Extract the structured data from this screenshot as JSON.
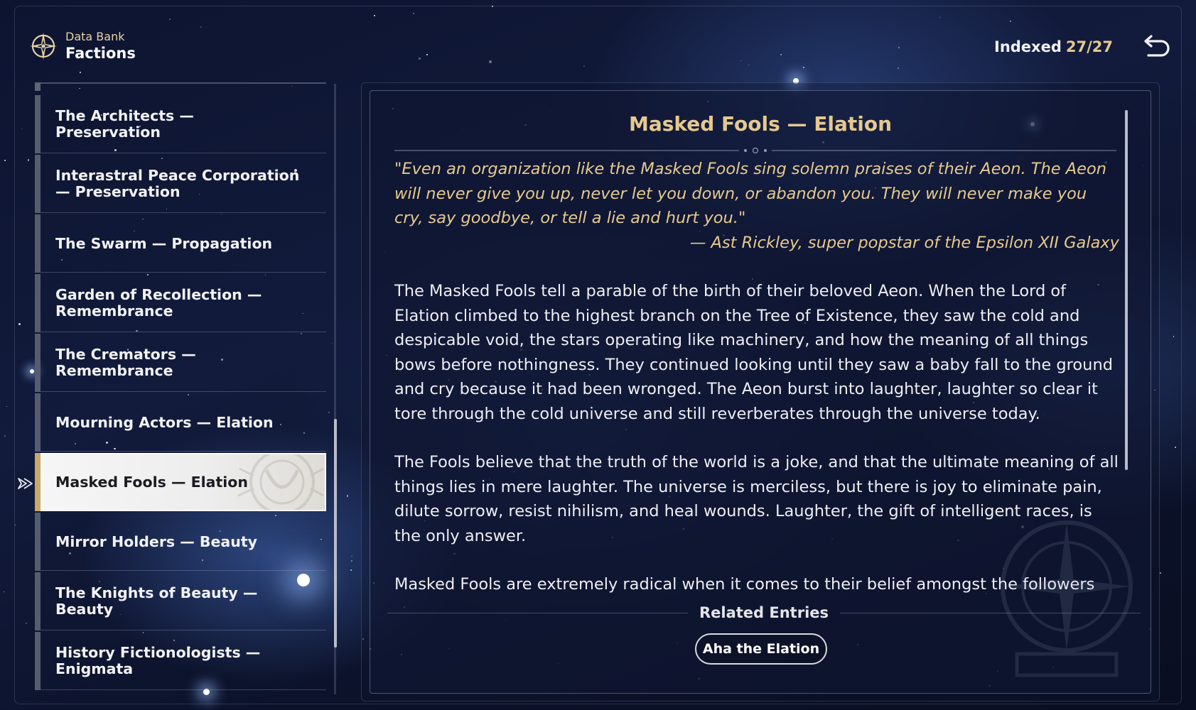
{
  "header": {
    "subtitle": "Data Bank",
    "title": "Factions",
    "emblem_icon": "compass-star-icon"
  },
  "indexed": {
    "label": "Indexed",
    "count": "27/27"
  },
  "back_icon": "return-arrow-icon",
  "sidebar": {
    "items": [
      {
        "label": "The Architects — Preservation"
      },
      {
        "label": "Interastral Peace Corporation — Preservation"
      },
      {
        "label": "The Swarm — Propagation"
      },
      {
        "label": "Garden of Recollection — Remembrance"
      },
      {
        "label": "The Cremators — Remembrance"
      },
      {
        "label": "Mourning Actors — Elation"
      },
      {
        "label": "Masked Fools — Elation",
        "selected": true
      },
      {
        "label": "Mirror Holders — Beauty"
      },
      {
        "label": "The Knights of Beauty — Beauty"
      },
      {
        "label": "History Fictionologists — Enigmata"
      }
    ]
  },
  "detail": {
    "title": "Masked Fools — Elation",
    "quote": "\"Even an organization like the Masked Fools sing solemn praises of their Aeon. The Aeon will never give you up, never let you down, or abandon you. They will never make you cry, say goodbye, or tell a lie and hurt you.\"",
    "quote_author": "— Ast Rickley, super popstar of the Epsilon XII Galaxy",
    "paragraphs": [
      "The Masked Fools tell a parable of the birth of their beloved Aeon. When the Lord of Elation climbed to the highest branch on the Tree of Existence, they saw the cold and despicable void, the stars operating like machinery, and how the meaning of all things bows before nothingness. They continued looking until they saw a baby fall to the ground and cry because it had been wronged. The Aeon burst into laughter, laughter so clear it tore through the cold universe and still reverberates through the universe today.",
      "The Fools believe that the truth of the world is a joke, and that the ultimate meaning of all things lies in mere laughter. The universe is merciless, but there is joy to eliminate pain, dilute sorrow, resist nihilism, and heal wounds. Laughter, the gift of intelligent races, is the only answer.",
      "Masked Fools are extremely radical when it comes to their belief amongst the followers"
    ],
    "related_title": "Related Entries",
    "related_entries": [
      "Aha the Elation"
    ]
  },
  "colors": {
    "accent_gold": "#e6c98e",
    "text_light": "#eeeef3",
    "selected_bg": "#f4f4f4",
    "selected_bar": "#c9a96a"
  }
}
